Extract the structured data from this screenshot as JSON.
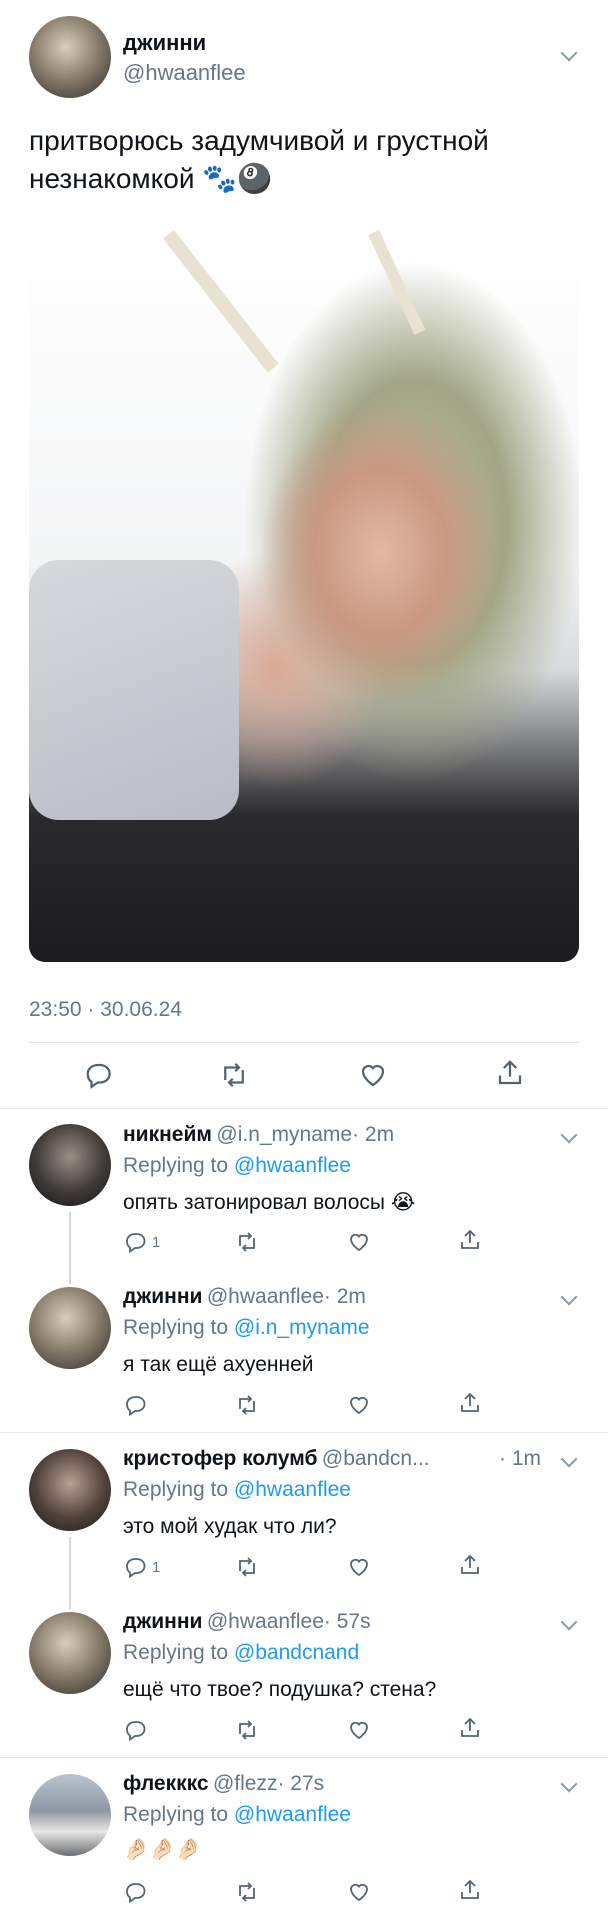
{
  "main_tweet": {
    "author_name": "джинни",
    "author_handle": "@hwaanflee",
    "text": "притворюсь задумчивой и грустной незнакомкой 🐾🎱",
    "timestamp": "23:50 · 30.06.24"
  },
  "replies": [
    {
      "name": "никнейм",
      "handle": "@i.n_myname",
      "time": "· 2m",
      "replying_label": "Replying to",
      "replying_to": "@hwaanflee",
      "text": "опять затонировал волосы 😭",
      "reply_count": "1"
    },
    {
      "name": "джинни",
      "handle": "@hwaanflee",
      "time": "· 2m",
      "replying_label": "Replying to",
      "replying_to": "@i.n_myname",
      "text": "я так ещё ахуенней",
      "reply_count": ""
    },
    {
      "name": "кристофер колумб",
      "handle": "@bandcn...",
      "time": "· 1m",
      "replying_label": "Replying to",
      "replying_to": "@hwaanflee",
      "text": "это мой худак что ли?",
      "reply_count": "1"
    },
    {
      "name": "джинни",
      "handle": "@hwaanflee",
      "time": "· 57s",
      "replying_label": "Replying to",
      "replying_to": "@bandcnand",
      "text": "ещё что твое? подушка? стена?",
      "reply_count": ""
    },
    {
      "name": "флекккс",
      "handle": "@flezz",
      "time": "· 27s",
      "replying_label": "Replying to",
      "replying_to": "@hwaanflee",
      "text": "🤌🏻🤌🏻🤌🏻",
      "reply_count": ""
    }
  ],
  "icons": {
    "reply": "speech-bubble-icon",
    "retweet": "retweet-icon",
    "like": "heart-icon",
    "share": "share-icon",
    "more": "chevron-down-icon"
  },
  "colors": {
    "link": "#1d9bf0",
    "secondary_text": "#657786",
    "divider": "#e1e8ed"
  }
}
